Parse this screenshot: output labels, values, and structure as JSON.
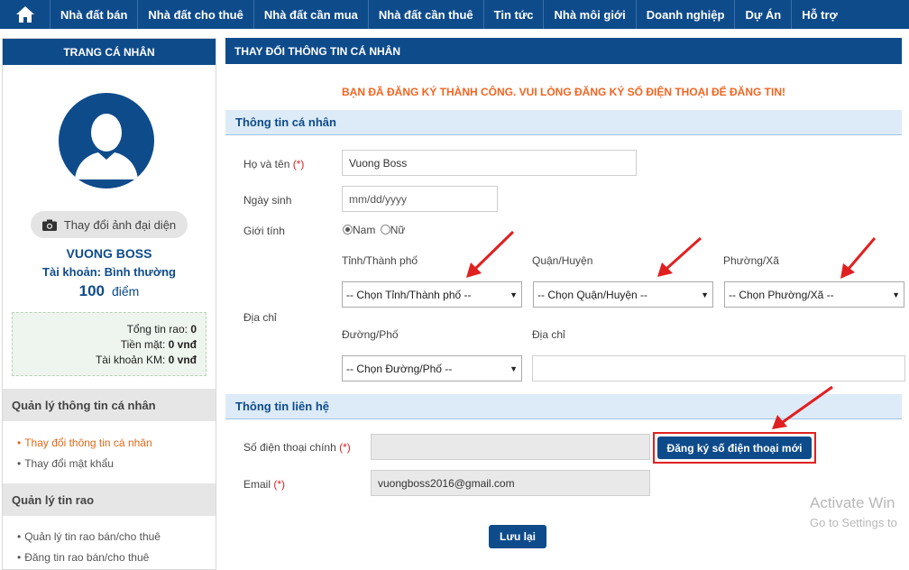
{
  "nav": {
    "home_icon": "home-icon",
    "items": [
      "Nhà đất bán",
      "Nhà đất cho thuê",
      "Nhà đất cần mua",
      "Nhà đất cần thuê",
      "Tin tức",
      "Nhà môi giới",
      "Doanh nghiệp",
      "Dự Án",
      "Hỗ trợ"
    ]
  },
  "sidebar": {
    "title": "TRANG CÁ NHÂN",
    "change_photo": "Thay đổi ảnh đại diện",
    "user_name": "VUONG BOSS",
    "account_type": "Tài khoản: Bình thường",
    "points": "100",
    "points_unit": "điểm",
    "stats": {
      "total_label": "Tổng tin rao:",
      "total_value": "0",
      "cash_label": "Tiền mặt:",
      "cash_value": "0 vnđ",
      "promo_label": "Tài khoản KM:",
      "promo_value": "0 vnđ"
    },
    "section1": "Quản lý thông tin cá nhân",
    "link_change_info": "Thay đổi thông tin cá nhân",
    "link_change_password": "Thay đổi mật khẩu",
    "section2": "Quản lý tin rao",
    "link_manage_ads": "Quản lý tin rao bán/cho thuê",
    "link_post_ad": "Đăng tin rao bán/cho thuê"
  },
  "main": {
    "title": "THAY ĐỔI THÔNG TIN CÁ NHÂN",
    "notice": "BẠN ĐÃ ĐĂNG KÝ THÀNH CÔNG. VUI LÒNG ĐĂNG KÝ SỐ ĐIỆN THOẠI ĐỂ ĐĂNG TIN!",
    "personal_section": "Thông tin cá nhân",
    "fullname_label": "Họ và tên",
    "required_mark": "(*)",
    "fullname_value": "Vuong Boss",
    "dob_label": "Ngày sinh",
    "dob_placeholder": "mm/dd/yyyy",
    "gender_label": "Giới tính",
    "gender_male": "Nam",
    "gender_female": "Nữ",
    "address_label": "Địa chỉ",
    "province_label": "Tỉnh/Thành phố",
    "province_value": "-- Chọn Tỉnh/Thành phố --",
    "district_label": "Quận/Huyện",
    "district_value": "-- Chọn Quận/Huyện --",
    "ward_label": "Phường/Xã",
    "ward_value": "-- Chọn Phường/Xã --",
    "street_label": "Đường/Phố",
    "street_value": "-- Chọn Đường/Phố --",
    "address_detail_label": "Địa chỉ",
    "address_detail_value": "",
    "contact_section": "Thông tin liên hệ",
    "phone_label": "Số điện thoại chính",
    "phone_value": "",
    "register_phone_button": "Đăng ký số điện thoại mới",
    "email_label": "Email",
    "email_value": "vuongboss2016@gmail.com",
    "save_button": "Lưu lại"
  },
  "watermark": {
    "line1": "Activate Win",
    "line2": "Go to Settings to"
  },
  "colors": {
    "brand": "#0e4b8b",
    "notice": "#f26522",
    "annotation": "#e02020"
  }
}
